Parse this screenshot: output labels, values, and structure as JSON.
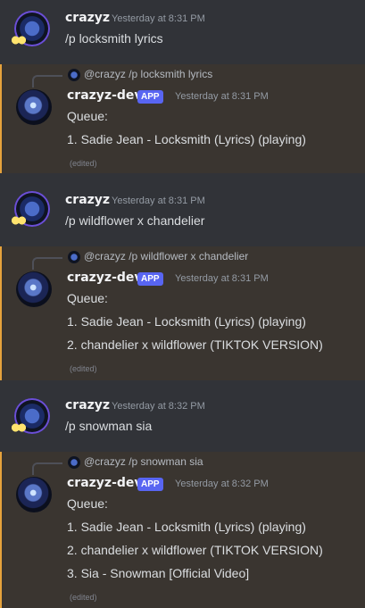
{
  "messages": [
    {
      "user": "crazyz",
      "time": "Yesterday at 8:31 PM",
      "text": "/p locksmith lyrics"
    },
    {
      "reply_user": "@crazyz",
      "reply_text": "/p locksmith lyrics",
      "user": "crazyz-dev",
      "badge": "APP",
      "time": "Yesterday at 8:31 PM",
      "queue_label": "Queue:",
      "lines": [
        "1. Sadie Jean - Locksmith (Lyrics) (playing)"
      ],
      "edited": "(edited)"
    },
    {
      "user": "crazyz",
      "time": "Yesterday at 8:31 PM",
      "text": "/p wildflower x chandelier"
    },
    {
      "reply_user": "@crazyz",
      "reply_text": "/p wildflower x chandelier",
      "user": "crazyz-dev",
      "badge": "APP",
      "time": "Yesterday at 8:31 PM",
      "queue_label": "Queue:",
      "lines": [
        "1. Sadie Jean - Locksmith (Lyrics) (playing)",
        "2. chandelier x wildflower (TIKTOK VERSION)"
      ],
      "edited": "(edited)"
    },
    {
      "user": "crazyz",
      "time": "Yesterday at 8:32 PM",
      "text": "/p snowman sia"
    },
    {
      "reply_user": "@crazyz",
      "reply_text": "/p snowman sia",
      "user": "crazyz-dev",
      "badge": "APP",
      "time": "Yesterday at 8:32 PM",
      "queue_label": "Queue:",
      "lines": [
        "1. Sadie Jean - Locksmith (Lyrics) (playing)",
        "2. chandelier x wildflower (TIKTOK VERSION)",
        "3. Sia - Snowman [Official Video]"
      ],
      "edited": "(edited)"
    }
  ],
  "colors": {
    "background": "#313338",
    "bot_highlight": "#3a3530",
    "bot_highlight_border": "#e6a23c",
    "app_badge": "#5865f2",
    "username": "#f2f3f5",
    "timestamp": "#949ba4",
    "text": "#dbdee1"
  },
  "icons": {
    "user_avatar": "crazyz-avatar-icon",
    "bot_avatar": "crazyz-dev-avatar-icon",
    "reply_avatar": "reply-avatar-icon"
  }
}
